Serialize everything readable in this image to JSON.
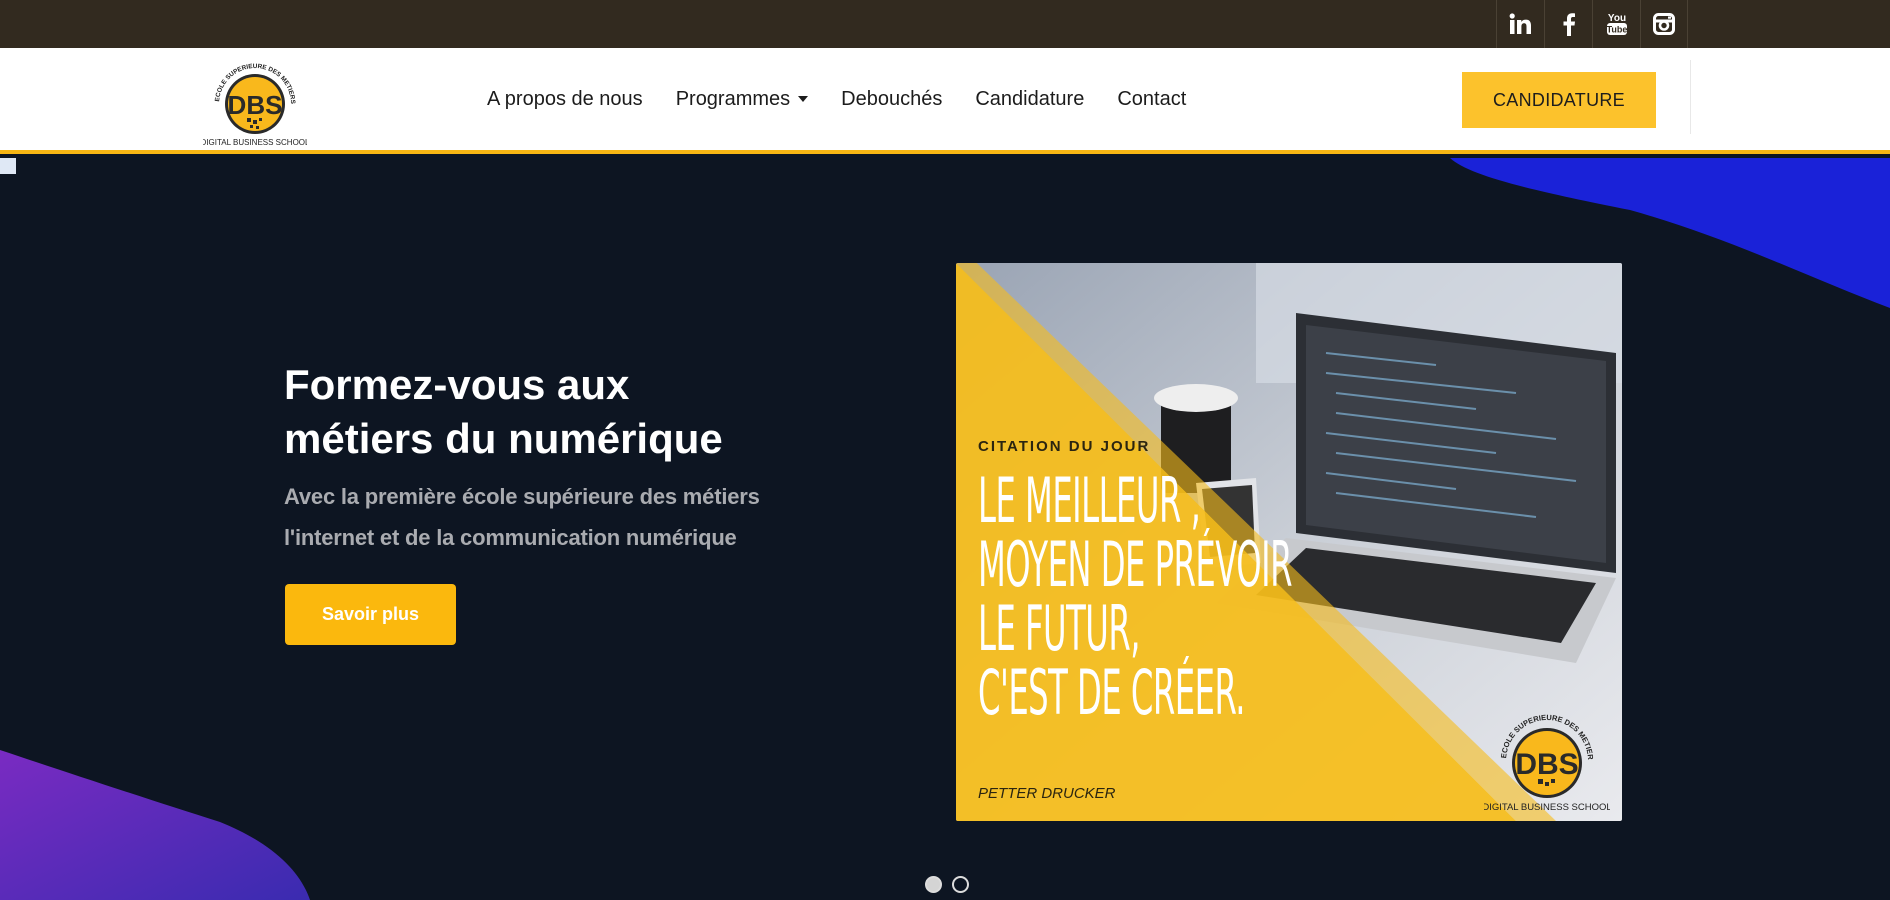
{
  "social": {
    "linkedin_label": "in",
    "facebook_label": "f",
    "youtube_label": "You Tube",
    "instagram_label": "instagram"
  },
  "logo": {
    "arc_text": "ECOLE SUPERIEURE DES METIERS DU WEB",
    "initials": "DBS",
    "name": "DIGITAL BUSINESS SCHOOL"
  },
  "nav": {
    "items": [
      {
        "label": "A propos de nous"
      },
      {
        "label": "Programmes"
      },
      {
        "label": "Debouchés"
      },
      {
        "label": "Candidature"
      },
      {
        "label": "Contact"
      }
    ],
    "cta_label": "CANDIDATURE"
  },
  "hero": {
    "title_line1": "Formez-vous aux",
    "title_line2": "métiers du numérique",
    "subtitle_line1": "Avec la première école supérieure des métiers",
    "subtitle_line2": "l'internet et de la communication numérique",
    "button_label": "Savoir plus"
  },
  "slide": {
    "label": "CITATION DU JOUR",
    "quote_line1": "LE MEILLEUR ,",
    "quote_line2": "MOYEN DE PRÉVOIR",
    "quote_line3": "LE FUTUR,",
    "quote_line4": "C'EST DE CRÉER.",
    "author": "PETTER DRUCKER"
  },
  "carousel": {
    "slide_count": 2,
    "active_index": 0
  },
  "colors": {
    "topbar": "#322a1f",
    "accent_yellow": "#fcc22c",
    "hero_bg": "#0d1522",
    "blob_blue": "#1a22d8",
    "blob_purple": "#6a2fc4"
  },
  "icons": [
    "linkedin-icon",
    "facebook-icon",
    "youtube-icon",
    "instagram-icon",
    "caret-down-icon"
  ]
}
